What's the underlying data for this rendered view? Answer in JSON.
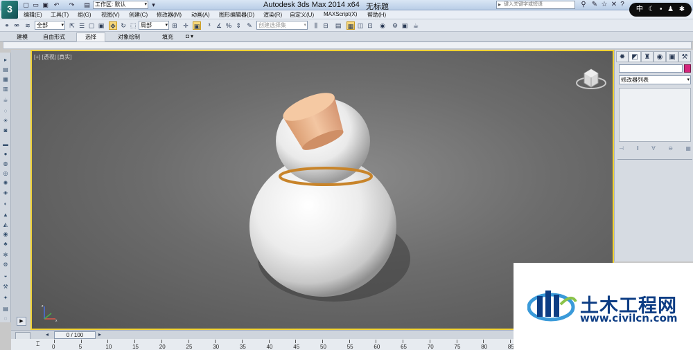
{
  "title_bar": {
    "app_title": "Autodesk 3ds Max  2014 x64",
    "document_title": "无标题",
    "workspace_label": "工作区: 默认",
    "search_placeholder": "键入关键字或短语"
  },
  "menu": {
    "items": [
      "编辑(E)",
      "工具(T)",
      "组(G)",
      "视图(V)",
      "创建(C)",
      "修改器(M)",
      "动画(A)",
      "图形编辑器(D)",
      "渲染(R)",
      "自定义(U)",
      "MAXScript(X)",
      "帮助(H)"
    ]
  },
  "toolbar": {
    "selection_filter": "全部",
    "reference_coord": "局部",
    "named_selection_placeholder": "创建选择集"
  },
  "ribbon": {
    "tabs": [
      "建模",
      "自由形式",
      "选择",
      "对象绘制",
      "填充"
    ],
    "selected_tab": "选择",
    "extra": "◘ ▾"
  },
  "viewport": {
    "label": "[+] [透视] [真实]"
  },
  "command_panel": {
    "modifier_list": "修改器列表",
    "object_color": "#d4257c"
  },
  "timeline": {
    "frame_display": "0 / 100",
    "tick_labels": [
      "0",
      "5",
      "10",
      "15",
      "20",
      "25",
      "30",
      "35",
      "40",
      "45",
      "50",
      "55",
      "60",
      "65",
      "70",
      "75",
      "80",
      "85"
    ]
  },
  "ime": {
    "label": "中"
  },
  "watermark": {
    "title": "土木工程网",
    "url": "www.civilcn.com"
  },
  "colors": {
    "viewport_border": "#f2d332",
    "cork": "#e6b08a",
    "gourd_ring": "#c8842a"
  }
}
